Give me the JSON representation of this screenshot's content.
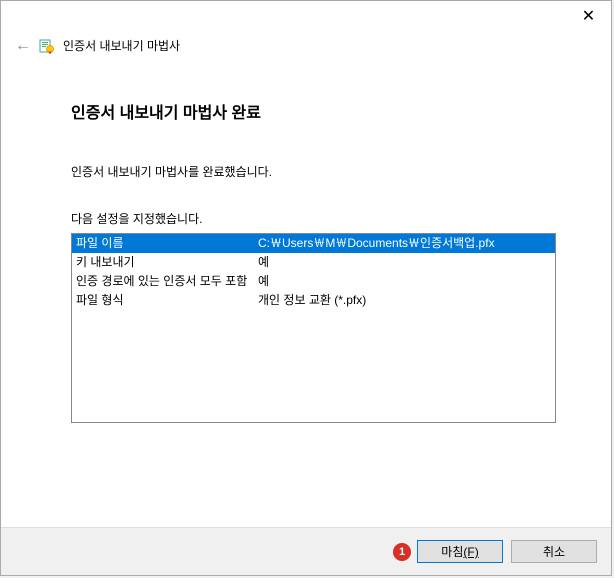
{
  "header": {
    "title": "인증서 내보내기 마법사"
  },
  "main": {
    "heading": "인증서 내보내기 마법사 완료",
    "statusText": "인증서 내보내기 마법사를 완료했습니다.",
    "settingsLabel": "다음 설정을 지정했습니다.",
    "rows": [
      {
        "key": "파일 이름",
        "value": "C:￦Users￦M￦Documents￦인증서백업.pfx",
        "selected": true
      },
      {
        "key": "키 내보내기",
        "value": "예",
        "selected": false
      },
      {
        "key": "인증 경로에 있는 인증서 모두 포함",
        "value": "예",
        "selected": false
      },
      {
        "key": "파일 형식",
        "value": "개인 정보 교환 (*.pfx)",
        "selected": false
      }
    ]
  },
  "footer": {
    "annotation": "1",
    "finishLabel": "마침",
    "finishMnemonic": "(F)",
    "cancelLabel": "취소"
  }
}
